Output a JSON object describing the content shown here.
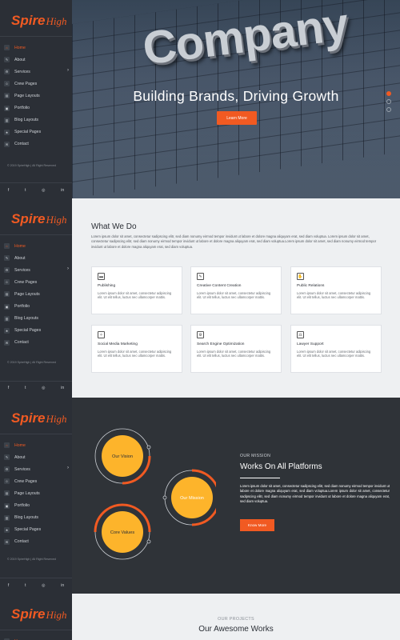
{
  "brand": {
    "logo_spire": "Spire",
    "logo_high": "High"
  },
  "nav": [
    {
      "label": "Home",
      "icon": "home-icon",
      "glyph": "⌂",
      "active": true
    },
    {
      "label": "About",
      "icon": "pencil-icon",
      "glyph": "✎",
      "active": false
    },
    {
      "label": "Services",
      "icon": "gear-icon",
      "glyph": "⚙",
      "active": false,
      "has_submenu": true
    },
    {
      "label": "Crew Pages",
      "icon": "users-icon",
      "glyph": "☺",
      "active": false
    },
    {
      "label": "Page Layouts",
      "icon": "layout-icon",
      "glyph": "▤",
      "active": false
    },
    {
      "label": "Portfolio",
      "icon": "briefcase-icon",
      "glyph": "▣",
      "active": false
    },
    {
      "label": "Blog Layouts",
      "icon": "blog-icon",
      "glyph": "▥",
      "active": false
    },
    {
      "label": "Special Pages",
      "icon": "star-icon",
      "glyph": "★",
      "active": false
    },
    {
      "label": "Contact",
      "icon": "envelope-icon",
      "glyph": "✉",
      "active": false
    }
  ],
  "copyright": "© 2019 SpireHigh | All Right Reserved",
  "social": [
    {
      "glyph": "f",
      "icon": "facebook-icon"
    },
    {
      "glyph": "t",
      "icon": "twitter-icon"
    },
    {
      "glyph": "◎",
      "icon": "instagram-icon"
    },
    {
      "glyph": "in",
      "icon": "linkedin-icon"
    }
  ],
  "hero": {
    "building_sign": "Company",
    "heading": "Building Brands, Driving Growth",
    "button": "Learn More"
  },
  "what_we_do": {
    "title": "What We Do",
    "paragraph": "Lorem ipsum dolor sit amet, consectetur sadipscing elitr, sed diam nonumy eirmod tempor invidunt ut labore et dolore magna aliquyam erat, sed diam voluptua. Lorem ipsum dolor sit amet, consectetur sadipscing elitr, sed diam nonumy eirmod tempor invidunt ut labore et dolore magna aliquyam erat, sed diam voluptua.Lorem ipsum dolor sit amet, sed diam nonumy eirmod tempor invidunt ut labore et dolore magna aliquyam erat, sed diam voluptua.",
    "cards": [
      {
        "title": "Publishing",
        "icon": "publishing-icon",
        "glyph": "▬",
        "text": "Lorem ipsum dolor sit amet, consectetur adipiscing elit. Ut elit tellus, luctus nec ullamcorper mattis."
      },
      {
        "title": "Creative Content Creation",
        "icon": "pen-edit-icon",
        "glyph": "✎",
        "text": "Lorem ipsum dolor sit amet, consectetur adipiscing elit. Ut elit tellus, luctus nec ullamcorper mattis."
      },
      {
        "title": "Public Relations",
        "icon": "handshake-icon",
        "glyph": "✋",
        "text": "Lorem ipsum dolor sit amet, consectetur adipiscing elit. Ut elit tellus, luctus nec ullamcorper mattis."
      },
      {
        "title": "Social Media Marketing",
        "icon": "social-media-icon",
        "glyph": "✧",
        "text": "Lorem ipsum dolor sit amet, consectetur adipiscing elit. Ut elit tellus, luctus nec ullamcorper mattis."
      },
      {
        "title": "Search Engine Optimization",
        "icon": "seo-gear-icon",
        "glyph": "⚙",
        "text": "Lorem ipsum dolor sit amet, consectetur adipiscing elit. Ut elit tellus, luctus nec ullamcorper mattis."
      },
      {
        "title": "Lawyer Support",
        "icon": "scales-icon",
        "glyph": "⚖",
        "text": "Lorem ipsum dolor sit amet, consectetur adipiscing elit. Ut elit tellus, luctus nec ullamcorper mattis."
      }
    ]
  },
  "mission": {
    "circle_1": "Our Vision",
    "circle_2": "Our Mission",
    "circle_3": "Core Values",
    "overline": "OUR MISSION",
    "title": "Works On All Platforms",
    "paragraph": "Lorem ipsum dolor sit amet, consectetur sadipscing elitr, sed diam nonumy eirmod tempor invidunt ut labore et dolore magna aliquyam erat, sed diam voluptua.Lorem ipsum dolor sit amet, consectetur sadipscing elitr, sed diam nonumy eirmod tempor invidunt ut labore et dolore magna aliquyam erat, sed diam voluptua.",
    "button": "Know More"
  },
  "projects": {
    "overline": "OUR PROJECTS",
    "title": "Our Awesome Works"
  },
  "colors": {
    "accent": "#f15a22",
    "yellow": "#fdb42b",
    "sidebar": "#2b2f36",
    "light_bg": "#eef0f2"
  }
}
